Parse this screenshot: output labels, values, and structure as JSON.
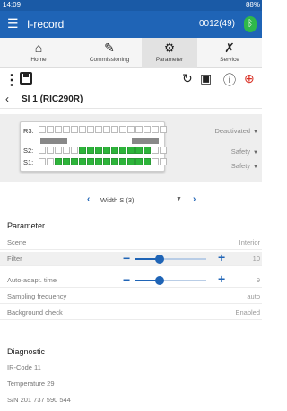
{
  "statusbar": {
    "time": "14:09",
    "right": "88%"
  },
  "appbar": {
    "menu_icon": "hamburger-icon",
    "title": "I-record",
    "device": "0012(49)",
    "bt_icon": "bluetooth-icon"
  },
  "tabs": [
    {
      "label": "Home",
      "icon": "home-icon",
      "glyph": "⌂"
    },
    {
      "label": "Commissioning",
      "icon": "edit-icon",
      "glyph": "✎"
    },
    {
      "label": "Parameter",
      "icon": "gear-icon",
      "glyph": "⚙"
    },
    {
      "label": "Service",
      "icon": "wrench-icon",
      "glyph": "🔧"
    }
  ],
  "toolbar": {
    "icons": [
      "more-icon",
      "save-icon",
      "reset-icon",
      "device-icon",
      "info-icon",
      "help-icon"
    ]
  },
  "breadcrumb": {
    "title": "SI 1 (RIC290R)"
  },
  "config": {
    "rows": [
      {
        "label": "R3:",
        "state": "Deactivated"
      },
      {
        "label": "S2:",
        "state": "Safety"
      },
      {
        "label": "S1:",
        "state": "Safety"
      }
    ]
  },
  "width": {
    "label": "Width S (3)"
  },
  "parameter": {
    "title": "Parameter",
    "rows": [
      {
        "label": "Scene",
        "value": "Interior"
      },
      {
        "label": "Filter",
        "value": "10",
        "slider": 0.35
      },
      {
        "label": "Auto-adapt. time",
        "value": "9",
        "slider": 0.35
      },
      {
        "label": "Sampling frequency",
        "value": "auto"
      },
      {
        "label": "Background check",
        "value": "Enabled"
      }
    ]
  },
  "diagnostic": {
    "title": "Diagnostic",
    "ir_code": "IR-Code  11",
    "temperature": "Temperature  29",
    "serial": "S/N  201 737 590 544"
  }
}
